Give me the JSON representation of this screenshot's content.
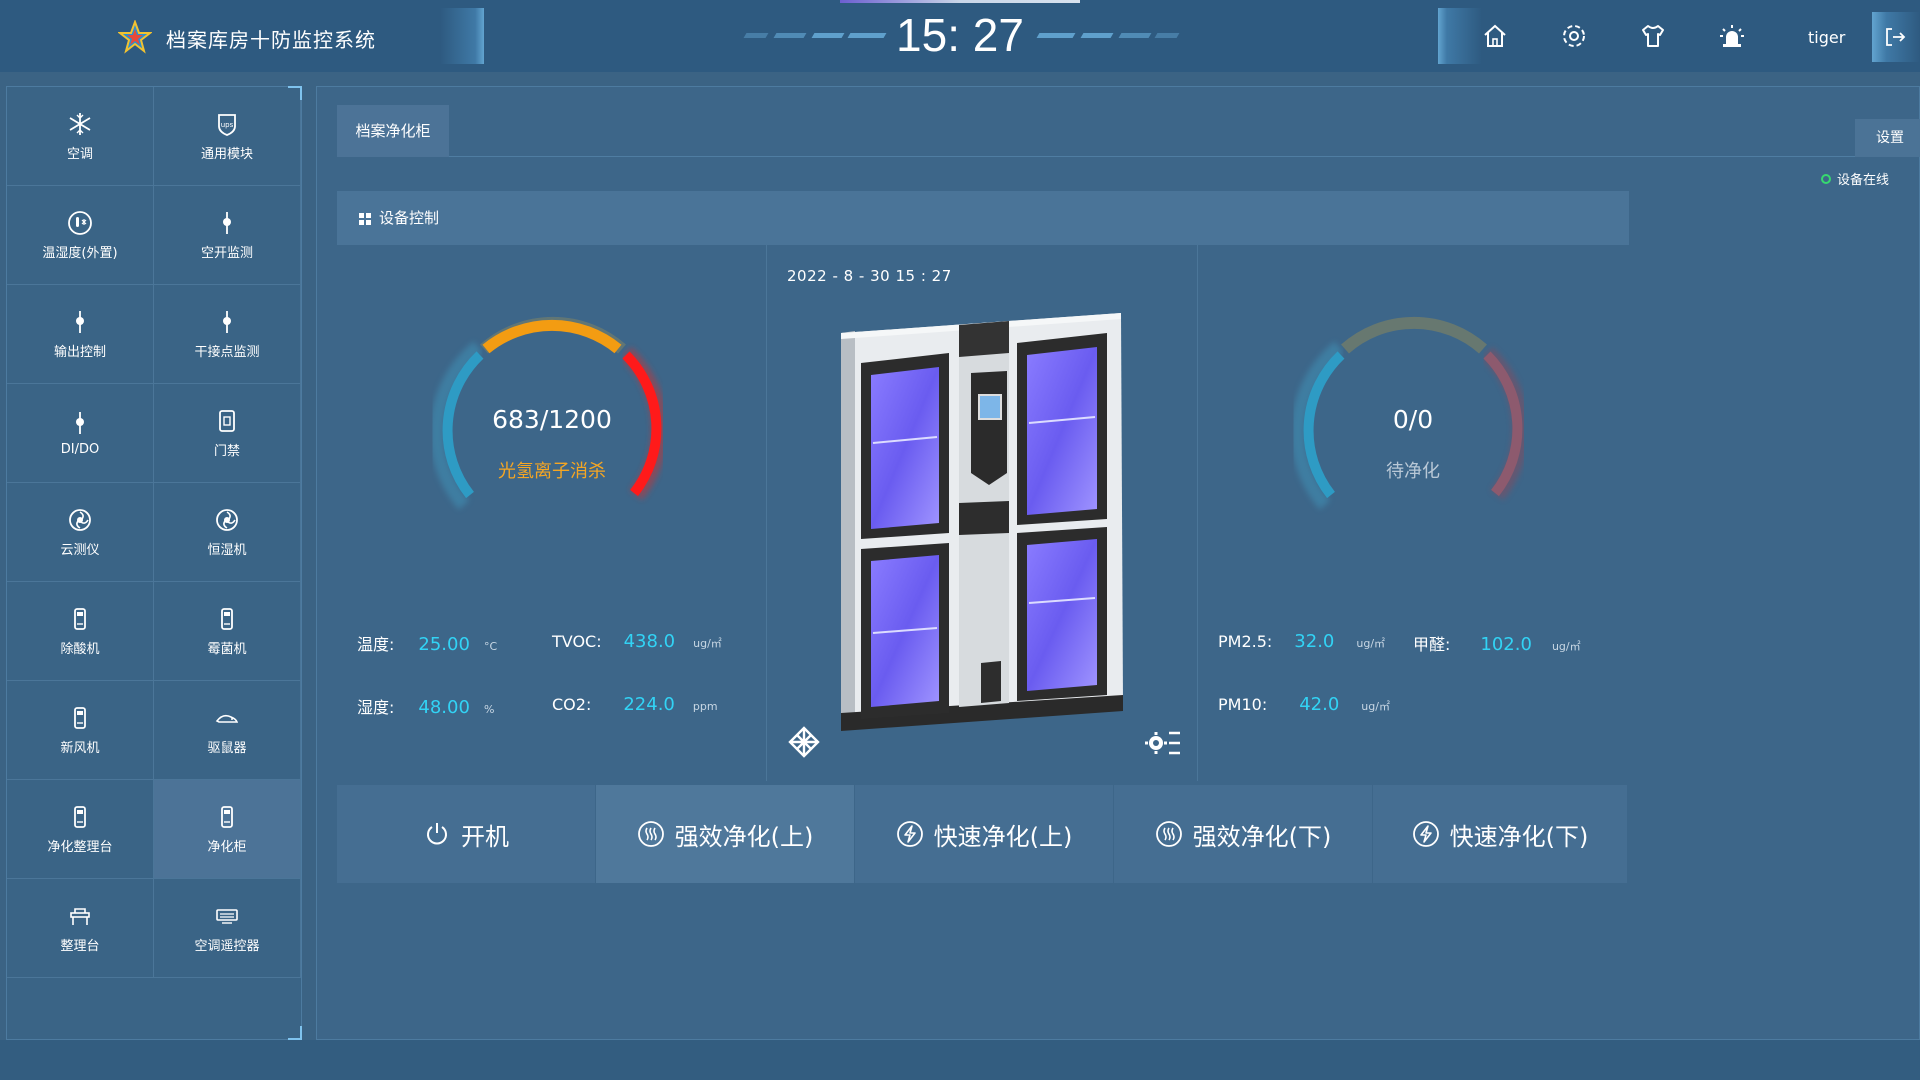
{
  "header": {
    "title": "档案库房十防监控系统",
    "clock": "15: 27",
    "user": "tiger",
    "nav": [
      "home-icon",
      "gear-icon",
      "shirt-icon",
      "alarm-light-icon",
      "logout-icon"
    ]
  },
  "sidebar": {
    "items": [
      {
        "label": "空调",
        "icon": "snowflake-icon"
      },
      {
        "label": "通用模块",
        "icon": "ups-icon"
      },
      {
        "label": "温湿度(外置)",
        "icon": "thermometer-icon"
      },
      {
        "label": "空开监测",
        "icon": "pin-icon"
      },
      {
        "label": "输出控制",
        "icon": "pin-icon"
      },
      {
        "label": "干接点监测",
        "icon": "pin-icon"
      },
      {
        "label": "DI/DO",
        "icon": "pin-icon"
      },
      {
        "label": "门禁",
        "icon": "door-icon"
      },
      {
        "label": "云测仪",
        "icon": "fan-icon"
      },
      {
        "label": "恒湿机",
        "icon": "fan-icon"
      },
      {
        "label": "除酸机",
        "icon": "device-icon"
      },
      {
        "label": "霉菌机",
        "icon": "device-icon"
      },
      {
        "label": "新风机",
        "icon": "device-icon"
      },
      {
        "label": "驱鼠器",
        "icon": "mouse-icon"
      },
      {
        "label": "净化整理台",
        "icon": "device-icon"
      },
      {
        "label": "净化柜",
        "icon": "device-icon"
      },
      {
        "label": "整理台",
        "icon": "desk-icon"
      },
      {
        "label": "空调遥控器",
        "icon": "remote-icon"
      }
    ],
    "active_index": 15
  },
  "main": {
    "tab": "档案净化柜",
    "settings_label": "设置",
    "status_text": "设备在线",
    "status_color": "#37d96f",
    "panel_title": "设备控制",
    "left_gauge": {
      "value": "683/1200",
      "label": "光氢离子消杀",
      "fraction": 0.569,
      "label_color": "#f5a623"
    },
    "right_gauge": {
      "value": "0/0",
      "label": "待净化",
      "fraction": 0
    },
    "datetime": "2022 - 8 - 30   15 : 27",
    "left_readings": {
      "temp_name": "温度:",
      "temp_value": "25.00",
      "temp_unit": "°C",
      "tvoc_name": "TVOC:",
      "tvoc_value": "438.0",
      "tvoc_unit": "ug/㎡",
      "hum_name": "湿度:",
      "hum_value": "48.00",
      "hum_unit": "%",
      "co2_name": "CO2:",
      "co2_value": "224.0",
      "co2_unit": "ppm"
    },
    "right_readings": {
      "pm25_name": "PM2.5:",
      "pm25_value": "32.0",
      "pm25_unit": "ug/㎡",
      "hcho_name": "甲醛:",
      "hcho_value": "102.0",
      "hcho_unit": "ug/㎡",
      "pm10_name": "PM10:",
      "pm10_value": "42.0",
      "pm10_unit": "ug/㎡"
    },
    "controls": [
      {
        "label": "开机",
        "icon": "power-icon"
      },
      {
        "label": "强效净化(上)",
        "icon": "heat-icon"
      },
      {
        "label": "快速净化(上)",
        "icon": "bolt-icon"
      },
      {
        "label": "强效净化(下)",
        "icon": "heat-icon"
      },
      {
        "label": "快速净化(下)",
        "icon": "bolt-icon"
      }
    ],
    "value_color": "#32d3f5"
  }
}
